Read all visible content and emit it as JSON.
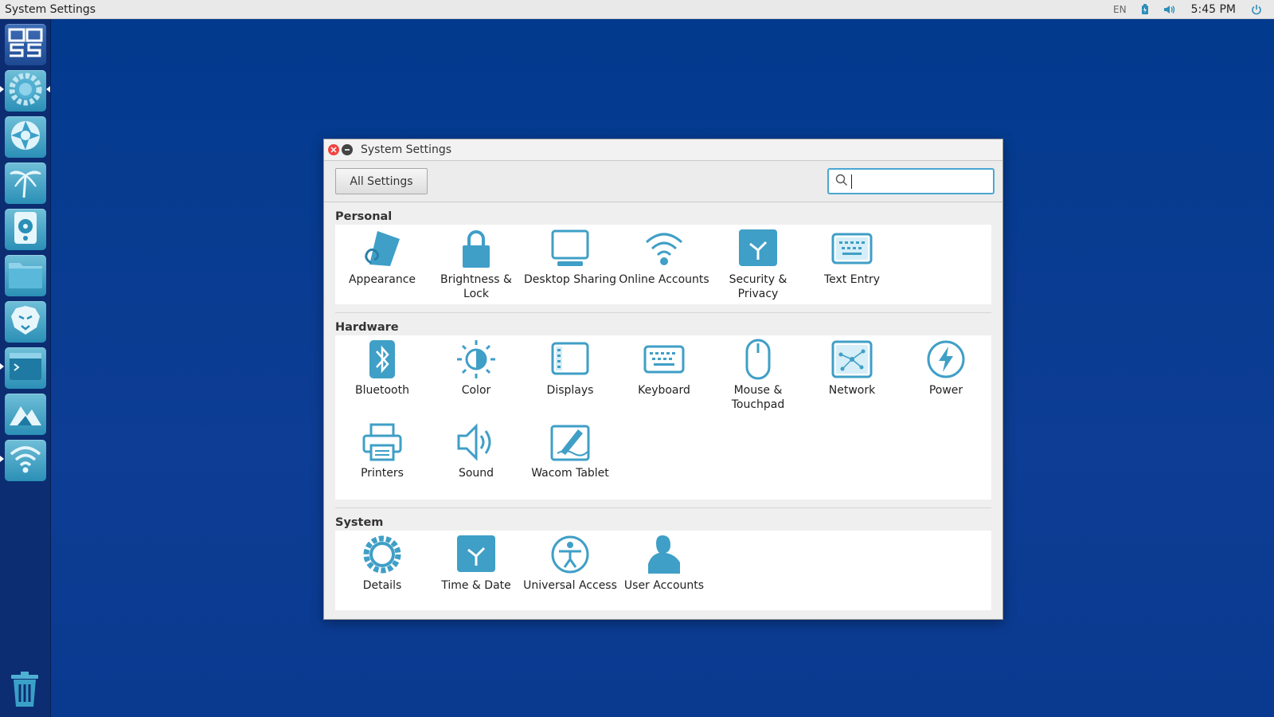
{
  "top_panel": {
    "app_title": "System Settings",
    "indicators": {
      "language": "EN",
      "battery_icon": "battery-icon",
      "volume_icon": "volume-icon",
      "clock": "5:45 PM",
      "power_icon": "power-icon"
    }
  },
  "launcher": {
    "items": [
      {
        "name": "boss-logo",
        "icon": "boss-logo-icon"
      },
      {
        "name": "system-settings",
        "icon": "gear-icon"
      },
      {
        "name": "aperture-app",
        "icon": "aperture-icon"
      },
      {
        "name": "palm-app",
        "icon": "palm-tree-icon"
      },
      {
        "name": "audio-player",
        "icon": "speaker-icon"
      },
      {
        "name": "files",
        "icon": "folder-icon"
      },
      {
        "name": "browser",
        "icon": "lion-icon"
      },
      {
        "name": "terminal",
        "icon": "terminal-icon"
      },
      {
        "name": "image-viewer",
        "icon": "mountain-icon"
      },
      {
        "name": "network-app",
        "icon": "wifi-icon"
      }
    ],
    "trash_icon": "trash-icon"
  },
  "window": {
    "title": "System Settings",
    "toolbar": {
      "all_settings_label": "All Settings",
      "search_value": ""
    },
    "sections": [
      {
        "title": "Personal",
        "items": [
          {
            "label": "Appearance",
            "icon": "appearance-icon"
          },
          {
            "label": "Brightness & Lock",
            "icon": "lock-icon"
          },
          {
            "label": "Desktop Sharing",
            "icon": "monitor-icon"
          },
          {
            "label": "Online Accounts",
            "icon": "wifi-icon"
          },
          {
            "label": "Security & Privacy",
            "icon": "security-icon"
          },
          {
            "label": "Text Entry",
            "icon": "keyboard-icon"
          }
        ]
      },
      {
        "title": "Hardware",
        "items": [
          {
            "label": "Bluetooth",
            "icon": "bluetooth-icon"
          },
          {
            "label": "Color",
            "icon": "color-icon"
          },
          {
            "label": "Displays",
            "icon": "displays-icon"
          },
          {
            "label": "Keyboard",
            "icon": "keyboard-icon"
          },
          {
            "label": "Mouse & Touchpad",
            "icon": "mouse-icon"
          },
          {
            "label": "Network",
            "icon": "network-icon"
          },
          {
            "label": "Power",
            "icon": "power-icon"
          },
          {
            "label": "Printers",
            "icon": "printer-icon"
          },
          {
            "label": "Sound",
            "icon": "sound-icon"
          },
          {
            "label": "Wacom Tablet",
            "icon": "tablet-icon"
          }
        ]
      },
      {
        "title": "System",
        "items": [
          {
            "label": "Details",
            "icon": "gear-icon"
          },
          {
            "label": "Time & Date",
            "icon": "clock-icon"
          },
          {
            "label": "Universal Access",
            "icon": "accessibility-icon"
          },
          {
            "label": "User Accounts",
            "icon": "user-icon"
          }
        ]
      }
    ]
  },
  "colors": {
    "accent": "#2d8fb9",
    "desktop": "#0a3a8c",
    "launcher": "#0c2d72"
  }
}
